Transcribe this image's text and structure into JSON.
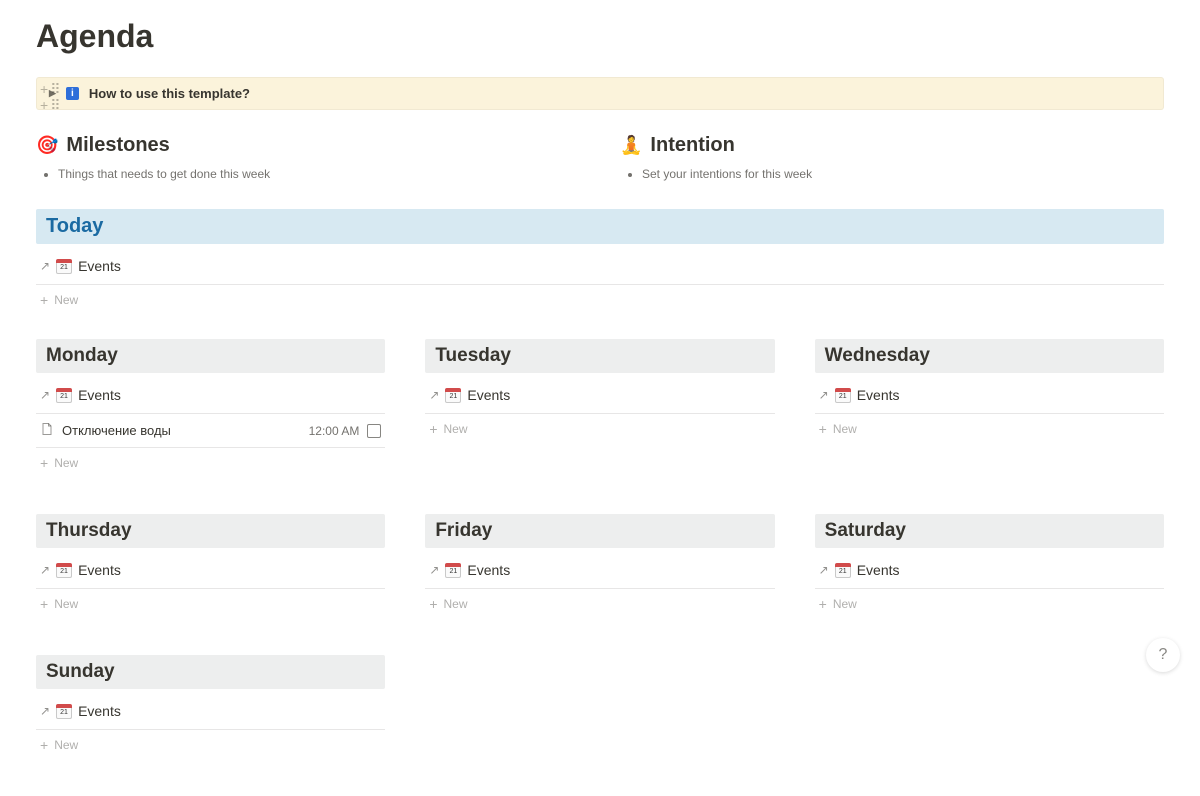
{
  "page": {
    "title": "Agenda"
  },
  "callout": {
    "text": "How to use this template?"
  },
  "milestones": {
    "heading": "Milestones",
    "emoji": "🎯",
    "items": [
      "Things that needs to get done this week"
    ]
  },
  "intention": {
    "heading": "Intention",
    "emoji": "🧘",
    "items": [
      "Set your intentions for this week"
    ]
  },
  "today": {
    "heading": "Today",
    "events_label": "Events",
    "new_label": "New"
  },
  "days": [
    {
      "name": "Monday",
      "events_label": "Events",
      "new_label": "New",
      "entries": [
        {
          "title": "Отключение воды",
          "time": "12:00 AM",
          "checked": false
        }
      ]
    },
    {
      "name": "Tuesday",
      "events_label": "Events",
      "new_label": "New",
      "entries": []
    },
    {
      "name": "Wednesday",
      "events_label": "Events",
      "new_label": "New",
      "entries": []
    },
    {
      "name": "Thursday",
      "events_label": "Events",
      "new_label": "New",
      "entries": []
    },
    {
      "name": "Friday",
      "events_label": "Events",
      "new_label": "New",
      "entries": []
    },
    {
      "name": "Saturday",
      "events_label": "Events",
      "new_label": "New",
      "entries": []
    },
    {
      "name": "Sunday",
      "events_label": "Events",
      "new_label": "New",
      "entries": []
    }
  ],
  "colors": {
    "today_bg": "#d7e9f2",
    "today_text": "#1a6aa2",
    "day_bg": "#edeeee",
    "callout_bg": "#fbf3db"
  }
}
